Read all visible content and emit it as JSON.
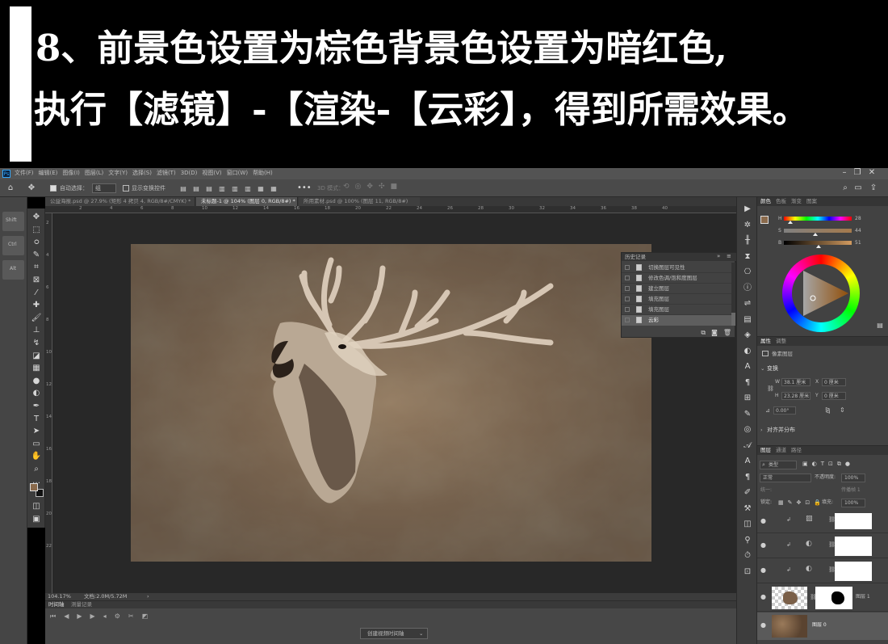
{
  "banner": {
    "line1": "8、前景色设置为棕色背景色设置为暗红色,",
    "line2": "执行【滤镜】-【渲染-【云彩】，得到所需效果。"
  },
  "app": {
    "logo": "Ps"
  },
  "menu": [
    "文件(F)",
    "编辑(E)",
    "图像(I)",
    "图层(L)",
    "文字(Y)",
    "选择(S)",
    "滤镜(T)",
    "3D(D)",
    "视图(V)",
    "窗口(W)",
    "帮助(H)"
  ],
  "options": {
    "auto_select_label": "自动选择：",
    "auto_select_value": "组",
    "transform_label": "显示变换控件",
    "mode_3d": "3D 模式："
  },
  "tabs": [
    {
      "label": "公益海报.psd @ 27.9% (矩形 4 拷贝 4, RGB/8#/CMYK) *"
    },
    {
      "label": "未标题-1 @ 104% (图层 0, RGB/8#) *"
    },
    {
      "label": "所用素材.psd @ 100% (图层 11, RGB/8#)"
    }
  ],
  "ruler_top": [
    "2",
    "4",
    "6",
    "8",
    "10",
    "12",
    "14",
    "16",
    "18",
    "20",
    "22",
    "24",
    "26",
    "28",
    "30",
    "32",
    "34",
    "36",
    "38",
    "40"
  ],
  "ruler_left": [
    "2",
    "4",
    "6",
    "8",
    "10",
    "12",
    "14",
    "16",
    "18",
    "20",
    "22"
  ],
  "keys": [
    "Shift",
    "Ctrl",
    "Alt"
  ],
  "status": {
    "zoom": "104.17%",
    "doc": "文档:2.0M/5.72M"
  },
  "timeline": {
    "tab1": "时间轴",
    "tab2": "测量记录",
    "create": "创建视频时间轴"
  },
  "history": {
    "title": "历史记录",
    "items": [
      "切换图层可见性",
      "修改色调/饱和度图层",
      "建立图层",
      "填充图层",
      "填充图层",
      "云彩"
    ]
  },
  "color": {
    "tabs": [
      "颜色",
      "色板",
      "渐变",
      "图案"
    ],
    "h_label": "H",
    "h_val": "28",
    "s_label": "S",
    "s_val": "44",
    "b_label": "B",
    "b_val": "51",
    "fg_color": "#8a6a4c",
    "bg_color": "#5a1a1a"
  },
  "properties": {
    "tabs": [
      "属性",
      "调整"
    ],
    "layer_type": "像素图层",
    "section": "变换",
    "w_label": "W",
    "w_val": "38.1 厘米",
    "h_label": "H",
    "h_val": "23.28 厘米",
    "x_label": "X",
    "x_val": "0 厘米",
    "y_label": "Y",
    "y_val": "0 厘米",
    "angle": "0.00°",
    "align": "对齐并分布"
  },
  "layers": {
    "tabs": [
      "图层",
      "通道",
      "路径"
    ],
    "filter": "类型",
    "blend": "正常",
    "opacity_label": "不透明度:",
    "opacity_val": "100%",
    "lock_label": "锁定:",
    "fill_label": "填充:",
    "fill_val": "100%",
    "unify": "统一:",
    "propagate": "传播帧 1",
    "rows": [
      {
        "name": "",
        "vis": "👁"
      },
      {
        "name": "",
        "vis": "👁"
      },
      {
        "name": "",
        "vis": "👁"
      },
      {
        "name": "图层 1",
        "vis": "👁"
      },
      {
        "name": "图层 0",
        "vis": "👁"
      }
    ]
  }
}
